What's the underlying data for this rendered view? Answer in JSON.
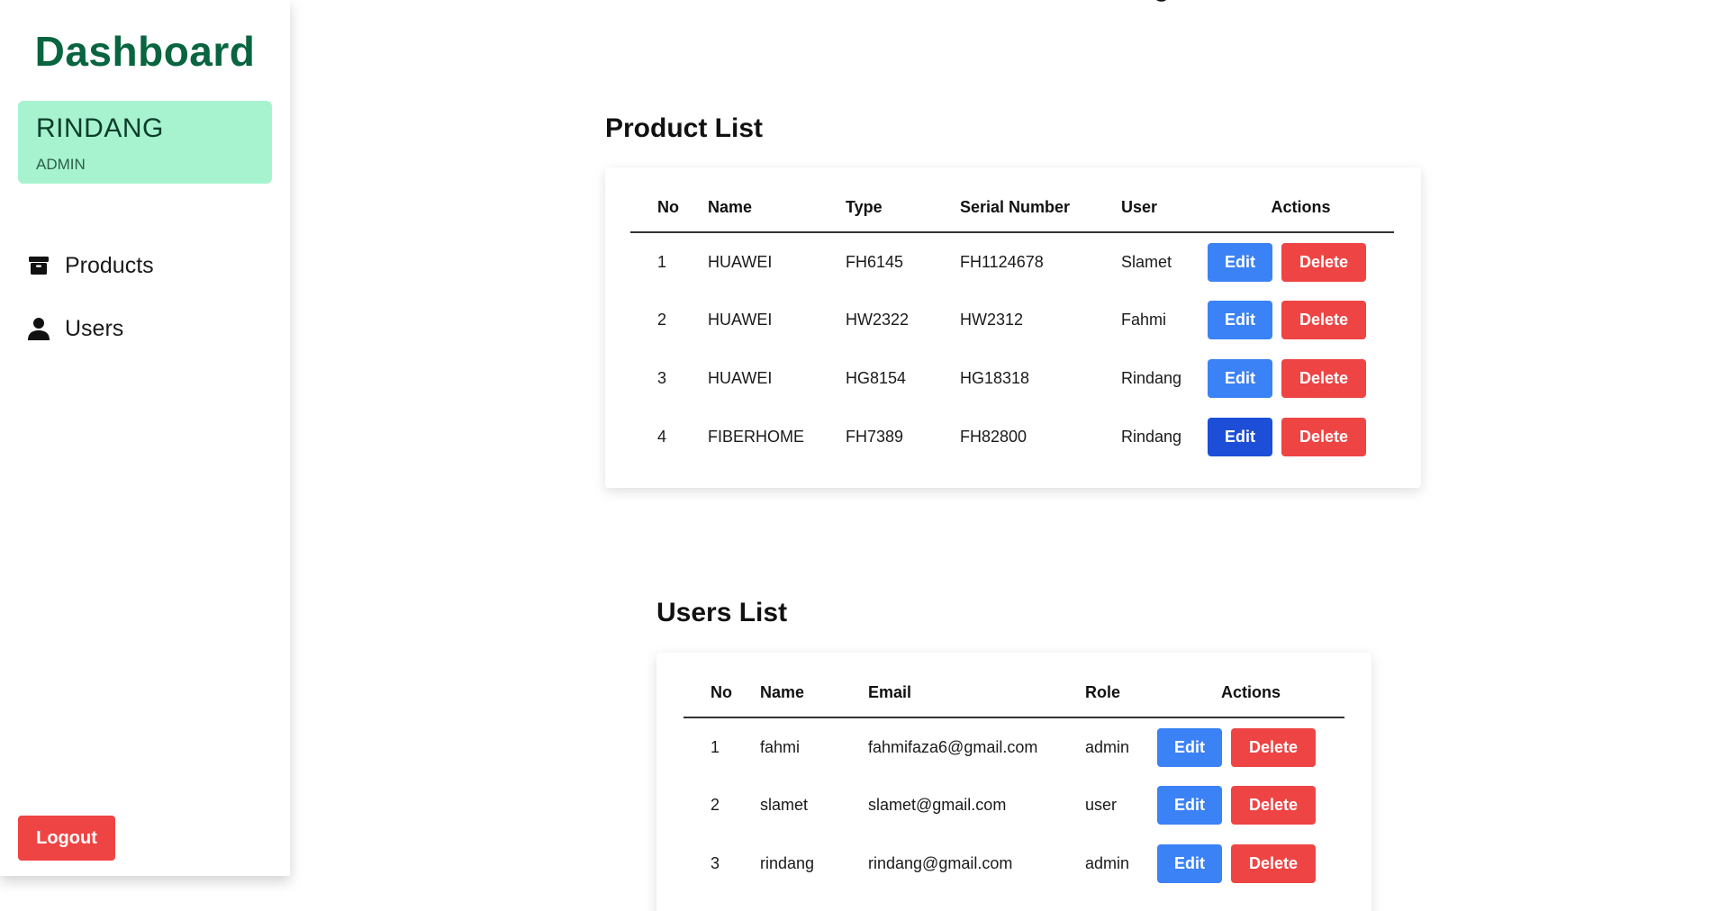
{
  "sidebar": {
    "brand": "Dashboard",
    "profile": {
      "name": "RINDANG",
      "role": "ADMIN"
    },
    "nav": [
      {
        "label": "Products",
        "icon": "box-icon"
      },
      {
        "label": "Users",
        "icon": "user-icon"
      }
    ],
    "logout_label": "Logout"
  },
  "products": {
    "title": "Product List",
    "columns": [
      "No",
      "Name",
      "Type",
      "Serial Number",
      "User",
      "Actions"
    ],
    "rows": [
      {
        "no": "1",
        "name": "HUAWEI",
        "type": "FH6145",
        "serial": "FH1124678",
        "user": "Slamet"
      },
      {
        "no": "2",
        "name": "HUAWEI",
        "type": "HW2322",
        "serial": "HW2312",
        "user": "Fahmi"
      },
      {
        "no": "3",
        "name": "HUAWEI",
        "type": "HG8154",
        "serial": "HG18318",
        "user": "Rindang"
      },
      {
        "no": "4",
        "name": "FIBERHOME",
        "type": "FH7389",
        "serial": "FH82800",
        "user": "Rindang"
      }
    ]
  },
  "users": {
    "title": "Users List",
    "columns": [
      "No",
      "Name",
      "Email",
      "Role",
      "Actions"
    ],
    "rows": [
      {
        "no": "1",
        "name": "fahmi",
        "email": "fahmifaza6@gmail.com",
        "role": "admin"
      },
      {
        "no": "2",
        "name": "slamet",
        "email": "slamet@gmail.com",
        "role": "user"
      },
      {
        "no": "3",
        "name": "rindang",
        "email": "rindang@gmail.com",
        "role": "admin"
      }
    ]
  },
  "actions": {
    "edit": "Edit",
    "delete": "Delete"
  },
  "colors": {
    "brand": "#08653f",
    "profile_bg": "#a7f3d0",
    "edit": "#3b82f6",
    "edit_active": "#1d4ed8",
    "delete": "#ef4444"
  }
}
